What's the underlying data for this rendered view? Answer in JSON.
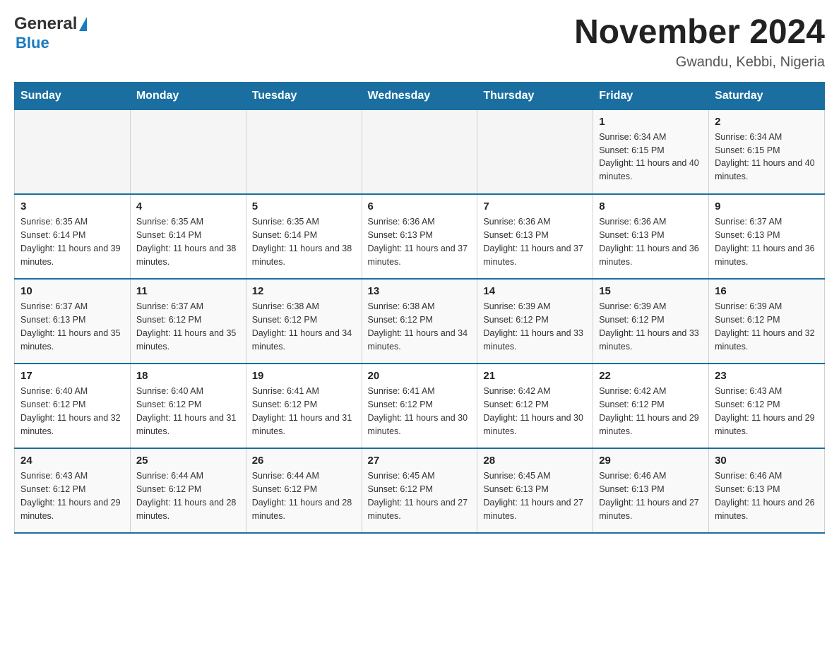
{
  "header": {
    "logo_general": "General",
    "logo_blue": "Blue",
    "title": "November 2024",
    "subtitle": "Gwandu, Kebbi, Nigeria"
  },
  "days_of_week": [
    "Sunday",
    "Monday",
    "Tuesday",
    "Wednesday",
    "Thursday",
    "Friday",
    "Saturday"
  ],
  "weeks": [
    {
      "cells": [
        {
          "day": "",
          "info": ""
        },
        {
          "day": "",
          "info": ""
        },
        {
          "day": "",
          "info": ""
        },
        {
          "day": "",
          "info": ""
        },
        {
          "day": "",
          "info": ""
        },
        {
          "day": "1",
          "info": "Sunrise: 6:34 AM\nSunset: 6:15 PM\nDaylight: 11 hours and 40 minutes."
        },
        {
          "day": "2",
          "info": "Sunrise: 6:34 AM\nSunset: 6:15 PM\nDaylight: 11 hours and 40 minutes."
        }
      ]
    },
    {
      "cells": [
        {
          "day": "3",
          "info": "Sunrise: 6:35 AM\nSunset: 6:14 PM\nDaylight: 11 hours and 39 minutes."
        },
        {
          "day": "4",
          "info": "Sunrise: 6:35 AM\nSunset: 6:14 PM\nDaylight: 11 hours and 38 minutes."
        },
        {
          "day": "5",
          "info": "Sunrise: 6:35 AM\nSunset: 6:14 PM\nDaylight: 11 hours and 38 minutes."
        },
        {
          "day": "6",
          "info": "Sunrise: 6:36 AM\nSunset: 6:13 PM\nDaylight: 11 hours and 37 minutes."
        },
        {
          "day": "7",
          "info": "Sunrise: 6:36 AM\nSunset: 6:13 PM\nDaylight: 11 hours and 37 minutes."
        },
        {
          "day": "8",
          "info": "Sunrise: 6:36 AM\nSunset: 6:13 PM\nDaylight: 11 hours and 36 minutes."
        },
        {
          "day": "9",
          "info": "Sunrise: 6:37 AM\nSunset: 6:13 PM\nDaylight: 11 hours and 36 minutes."
        }
      ]
    },
    {
      "cells": [
        {
          "day": "10",
          "info": "Sunrise: 6:37 AM\nSunset: 6:13 PM\nDaylight: 11 hours and 35 minutes."
        },
        {
          "day": "11",
          "info": "Sunrise: 6:37 AM\nSunset: 6:12 PM\nDaylight: 11 hours and 35 minutes."
        },
        {
          "day": "12",
          "info": "Sunrise: 6:38 AM\nSunset: 6:12 PM\nDaylight: 11 hours and 34 minutes."
        },
        {
          "day": "13",
          "info": "Sunrise: 6:38 AM\nSunset: 6:12 PM\nDaylight: 11 hours and 34 minutes."
        },
        {
          "day": "14",
          "info": "Sunrise: 6:39 AM\nSunset: 6:12 PM\nDaylight: 11 hours and 33 minutes."
        },
        {
          "day": "15",
          "info": "Sunrise: 6:39 AM\nSunset: 6:12 PM\nDaylight: 11 hours and 33 minutes."
        },
        {
          "day": "16",
          "info": "Sunrise: 6:39 AM\nSunset: 6:12 PM\nDaylight: 11 hours and 32 minutes."
        }
      ]
    },
    {
      "cells": [
        {
          "day": "17",
          "info": "Sunrise: 6:40 AM\nSunset: 6:12 PM\nDaylight: 11 hours and 32 minutes."
        },
        {
          "day": "18",
          "info": "Sunrise: 6:40 AM\nSunset: 6:12 PM\nDaylight: 11 hours and 31 minutes."
        },
        {
          "day": "19",
          "info": "Sunrise: 6:41 AM\nSunset: 6:12 PM\nDaylight: 11 hours and 31 minutes."
        },
        {
          "day": "20",
          "info": "Sunrise: 6:41 AM\nSunset: 6:12 PM\nDaylight: 11 hours and 30 minutes."
        },
        {
          "day": "21",
          "info": "Sunrise: 6:42 AM\nSunset: 6:12 PM\nDaylight: 11 hours and 30 minutes."
        },
        {
          "day": "22",
          "info": "Sunrise: 6:42 AM\nSunset: 6:12 PM\nDaylight: 11 hours and 29 minutes."
        },
        {
          "day": "23",
          "info": "Sunrise: 6:43 AM\nSunset: 6:12 PM\nDaylight: 11 hours and 29 minutes."
        }
      ]
    },
    {
      "cells": [
        {
          "day": "24",
          "info": "Sunrise: 6:43 AM\nSunset: 6:12 PM\nDaylight: 11 hours and 29 minutes."
        },
        {
          "day": "25",
          "info": "Sunrise: 6:44 AM\nSunset: 6:12 PM\nDaylight: 11 hours and 28 minutes."
        },
        {
          "day": "26",
          "info": "Sunrise: 6:44 AM\nSunset: 6:12 PM\nDaylight: 11 hours and 28 minutes."
        },
        {
          "day": "27",
          "info": "Sunrise: 6:45 AM\nSunset: 6:12 PM\nDaylight: 11 hours and 27 minutes."
        },
        {
          "day": "28",
          "info": "Sunrise: 6:45 AM\nSunset: 6:13 PM\nDaylight: 11 hours and 27 minutes."
        },
        {
          "day": "29",
          "info": "Sunrise: 6:46 AM\nSunset: 6:13 PM\nDaylight: 11 hours and 27 minutes."
        },
        {
          "day": "30",
          "info": "Sunrise: 6:46 AM\nSunset: 6:13 PM\nDaylight: 11 hours and 26 minutes."
        }
      ]
    }
  ]
}
